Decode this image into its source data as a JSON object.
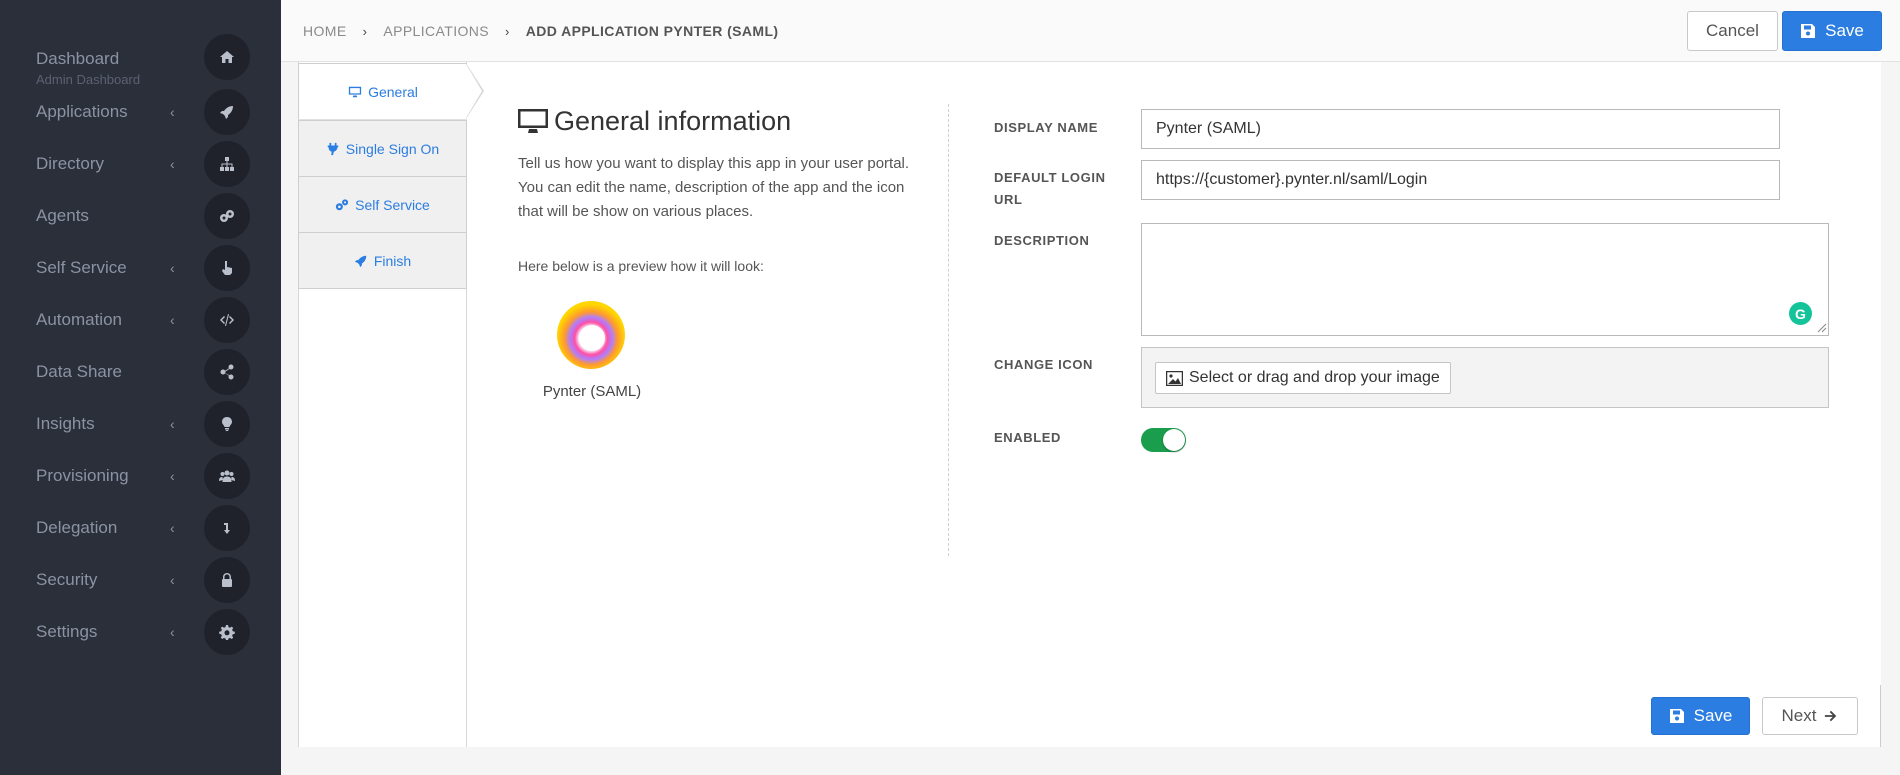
{
  "sidebar": {
    "items": [
      {
        "label": "Dashboard",
        "sub": "Admin Dashboard",
        "icon": "home-icon"
      },
      {
        "label": "Applications",
        "icon": "rocket-icon"
      },
      {
        "label": "Directory",
        "icon": "sitemap-icon"
      },
      {
        "label": "Agents",
        "icon": "cogs-icon"
      },
      {
        "label": "Self Service",
        "icon": "hand-pointer-icon"
      },
      {
        "label": "Automation",
        "icon": "code-icon"
      },
      {
        "label": "Data Share",
        "icon": "share-icon"
      },
      {
        "label": "Insights",
        "icon": "lightbulb-icon"
      },
      {
        "label": "Provisioning",
        "icon": "users-icon"
      },
      {
        "label": "Delegation",
        "icon": "level-down-icon"
      },
      {
        "label": "Security",
        "icon": "lock-icon"
      },
      {
        "label": "Settings",
        "icon": "gear-icon"
      }
    ],
    "chevron": "‹"
  },
  "breadcrumb": {
    "home": "HOME",
    "applications": "APPLICATIONS",
    "current": "ADD APPLICATION PYNTER (SAML)",
    "separator": "›"
  },
  "toolbar": {
    "cancel_label": "Cancel",
    "save_label": "Save"
  },
  "tabs": [
    {
      "label": "General",
      "icon": "desktop-icon"
    },
    {
      "label": "Single Sign On",
      "icon": "plug-icon"
    },
    {
      "label": "Self Service",
      "icon": "cogs-icon"
    },
    {
      "label": "Finish",
      "icon": "rocket-icon"
    }
  ],
  "general": {
    "title": "General information",
    "description": "Tell us how you want to display this app in your user portal. You can edit the name, description of the app and the icon that will be show on various places.",
    "preview_text": "Here below is a preview how it will look:",
    "app_name": "Pynter (SAML)"
  },
  "form": {
    "display_name_label": "DISPLAY NAME",
    "display_name_value": "Pynter (SAML)",
    "login_url_label_1": "DEFAULT LOGIN",
    "login_url_label_2": "URL",
    "login_url_value": "https://{customer}.pynter.nl/saml/Login",
    "description_label": "DESCRIPTION",
    "description_value": "",
    "change_icon_label": "CHANGE ICON",
    "change_icon_button": "Select or drag and drop your image",
    "enabled_label": "ENABLED",
    "enabled": true
  },
  "footer": {
    "save_label": "Save",
    "next_label": "Next"
  },
  "colors": {
    "sidebar_bg": "#2b2f3a",
    "primary": "#2b7de1",
    "toggle_on": "#1a9d4d"
  }
}
